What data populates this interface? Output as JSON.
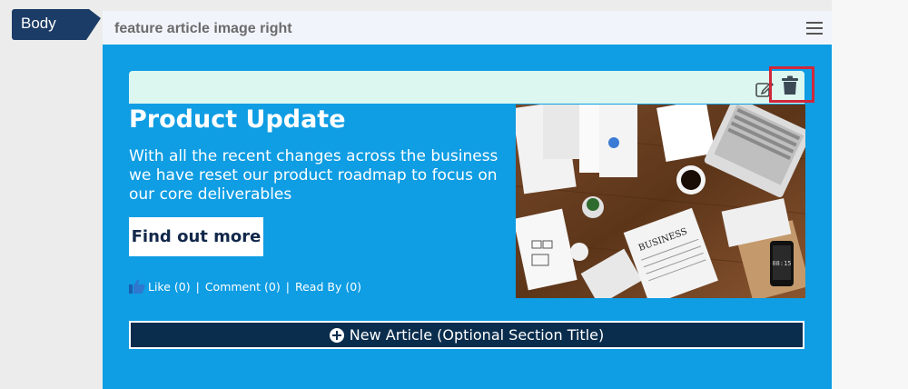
{
  "section_tab": {
    "label": "Body"
  },
  "panel": {
    "title": "feature article image right",
    "menu_icon": "hamburger-menu-icon"
  },
  "article": {
    "headline": "Product Update",
    "summary": "With all the recent changes across the business we have reset our product roadmap to focus on our core deliverables",
    "cta_label": "Find out more",
    "social": {
      "like": "Like (0)",
      "separator": "|",
      "comment": "Comment (0)",
      "read_by": "Read By (0)"
    },
    "image": {
      "description_icon": "desk-workspace-photo",
      "phone_time": "08:15",
      "newspaper_title": "BUSINESS"
    }
  },
  "toolbar": {
    "edit_icon": "edit-icon",
    "delete_icon": "trash-icon"
  },
  "new_article": {
    "label": "New Article (Optional Section Title)"
  },
  "colors": {
    "content_bg": "#0f9de3",
    "tab_bg": "#1b3c66",
    "toolbar_strip": "#dcf7f0",
    "highlight": "#d0283a",
    "new_article_bg": "#0a2d4d"
  }
}
